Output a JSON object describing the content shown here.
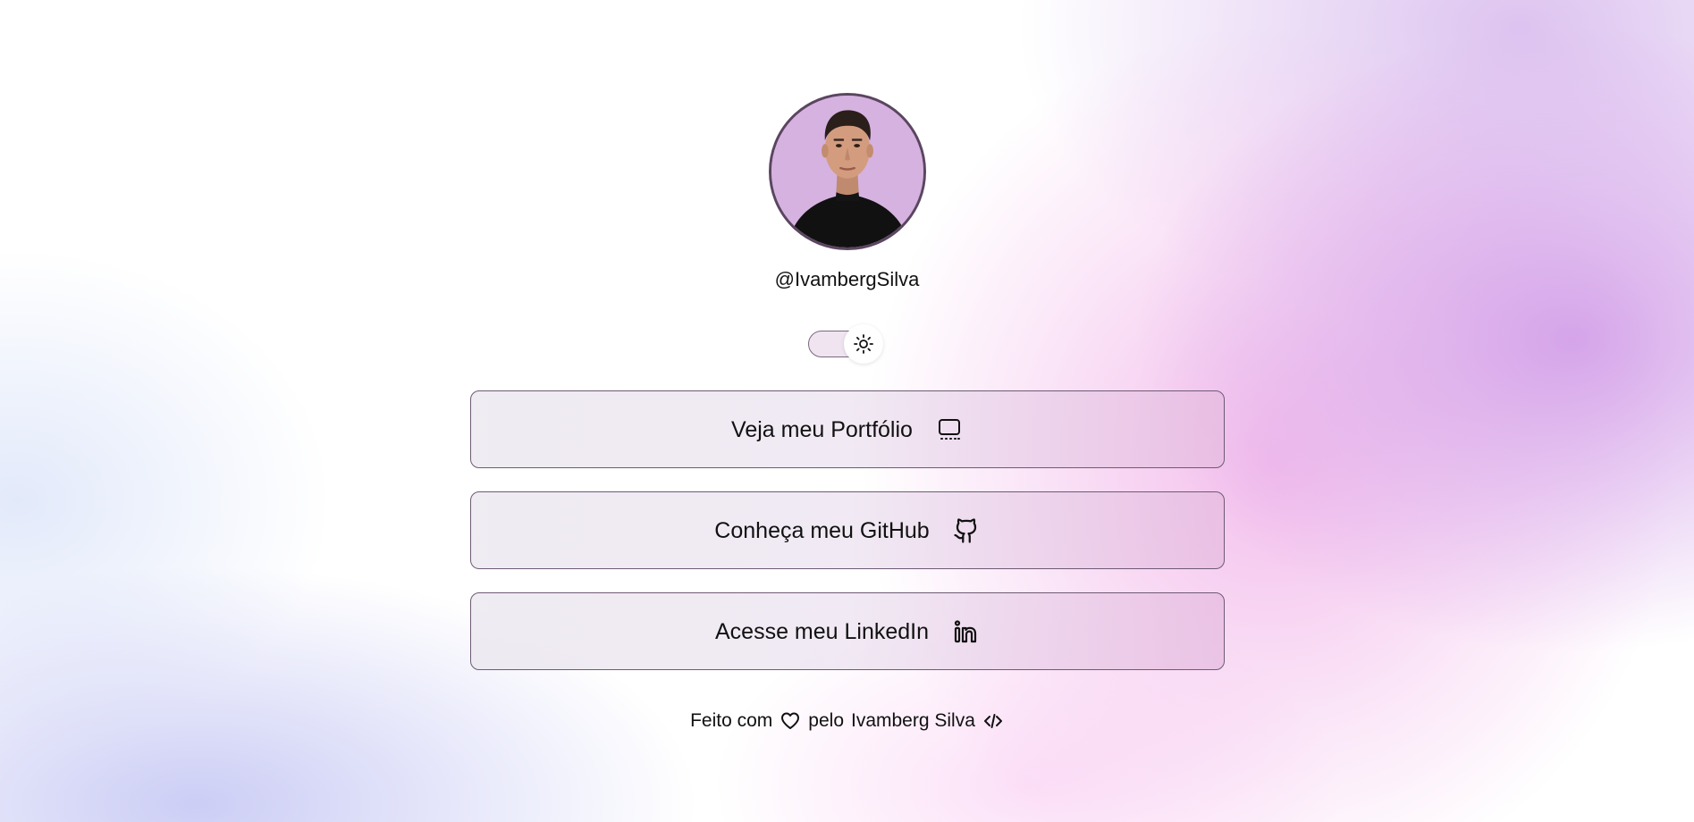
{
  "profile": {
    "username": "@IvambergSilva",
    "avatar_alt": "Ivamberg Silva"
  },
  "theme_toggle": {
    "state": "light",
    "icon": "sun-icon"
  },
  "links": [
    {
      "label": "Veja meu Portfólio",
      "icon": "monitor-icon"
    },
    {
      "label": "Conheça meu GitHub",
      "icon": "github-icon"
    },
    {
      "label": "Acesse meu LinkedIn",
      "icon": "linkedin-icon"
    }
  ],
  "footer": {
    "prefix": "Feito com",
    "heart_icon": "heart-icon",
    "by": "pelo",
    "author": "Ivamberg Silva",
    "code_icon": "code-icon"
  },
  "colors": {
    "button_border": "#6e5a74",
    "avatar_bg": "#d6b2e0",
    "accent_purple": "#ce96e6",
    "accent_pink": "#f0aae6"
  }
}
